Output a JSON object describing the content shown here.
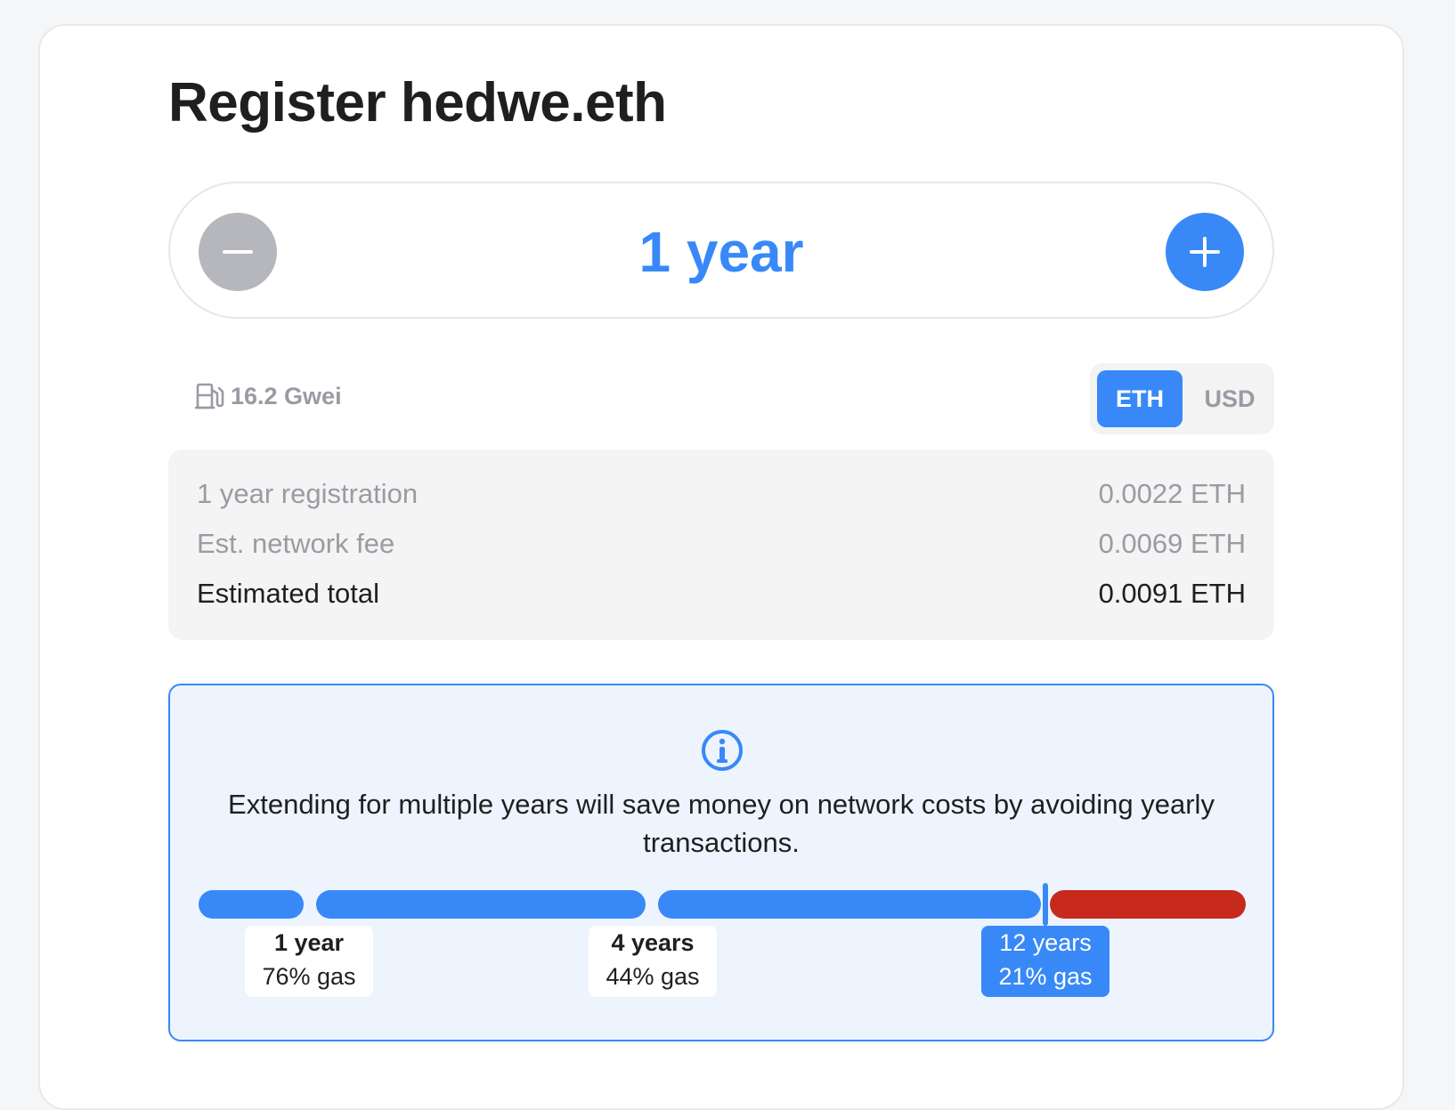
{
  "title": "Register hedwe.eth",
  "stepper": {
    "value": "1 year",
    "minus_icon": "minus-icon",
    "plus_icon": "plus-icon"
  },
  "gas": {
    "icon": "gas-pump-icon",
    "price": "16.2 Gwei"
  },
  "currency_toggle": {
    "options": [
      "ETH",
      "USD"
    ],
    "selected": "ETH"
  },
  "fees": {
    "registration_label": "1 year registration",
    "registration_value": "0.0022 ETH",
    "network_label": "Est. network fee",
    "network_value": "0.0069 ETH",
    "total_label": "Estimated total",
    "total_value": "0.0091 ETH"
  },
  "info": {
    "icon": "info-icon",
    "text": "Extending for multiple years will save money on network costs by avoiding yearly transactions.",
    "markers": [
      {
        "years": "1 year",
        "gas": "76% gas"
      },
      {
        "years": "4 years",
        "gas": "44% gas"
      },
      {
        "years": "12 years",
        "gas": "21% gas"
      }
    ],
    "selected_marker": "12 years"
  },
  "colors": {
    "accent": "#3889f7",
    "danger": "#c72a1c",
    "muted": "#9a9ba3"
  }
}
